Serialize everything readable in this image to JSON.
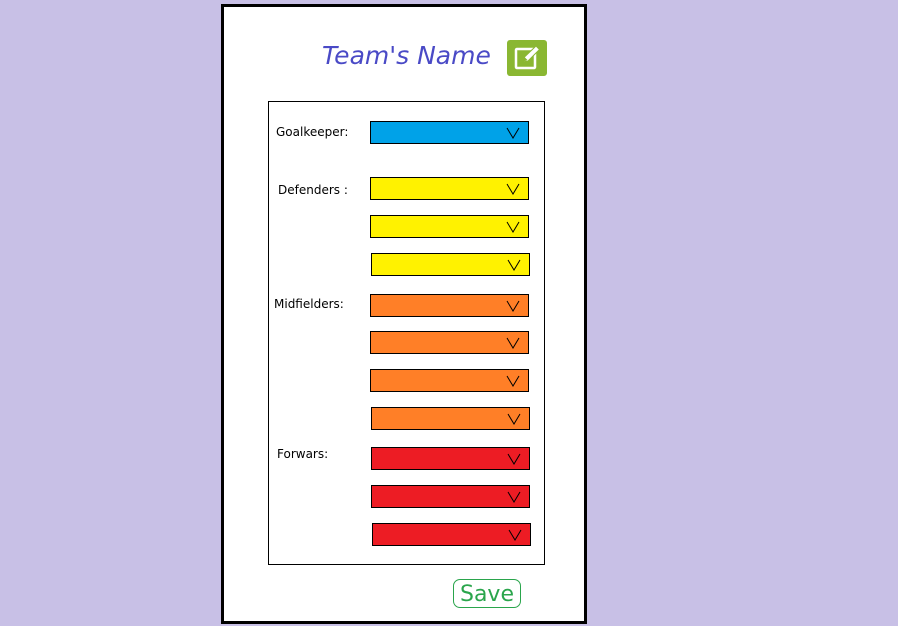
{
  "team": {
    "name": "Team's Name",
    "edit_icon": "edit-icon"
  },
  "lineup": {
    "goalkeeper": {
      "label": "Goalkeeper:",
      "color": "#00a2e8",
      "selects": [
        {
          "value": ""
        }
      ]
    },
    "defenders": {
      "label": "Defenders :",
      "color": "#fff200",
      "selects": [
        {
          "value": ""
        },
        {
          "value": ""
        },
        {
          "value": ""
        }
      ]
    },
    "midfielders": {
      "label": "Midfielders:",
      "color": "#ff7f27",
      "selects": [
        {
          "value": ""
        },
        {
          "value": ""
        },
        {
          "value": ""
        },
        {
          "value": ""
        }
      ]
    },
    "forwards": {
      "label": "Forwars:",
      "color": "#ed1c24",
      "selects": [
        {
          "value": ""
        },
        {
          "value": ""
        },
        {
          "value": ""
        }
      ]
    },
    "dropdown_icon": "chevron-down-icon"
  },
  "actions": {
    "save_label": "Save"
  },
  "colors": {
    "background": "#c8c0e6",
    "title": "#4a4ac6",
    "edit_button": "#8ab732",
    "save": "#2aa54c"
  }
}
